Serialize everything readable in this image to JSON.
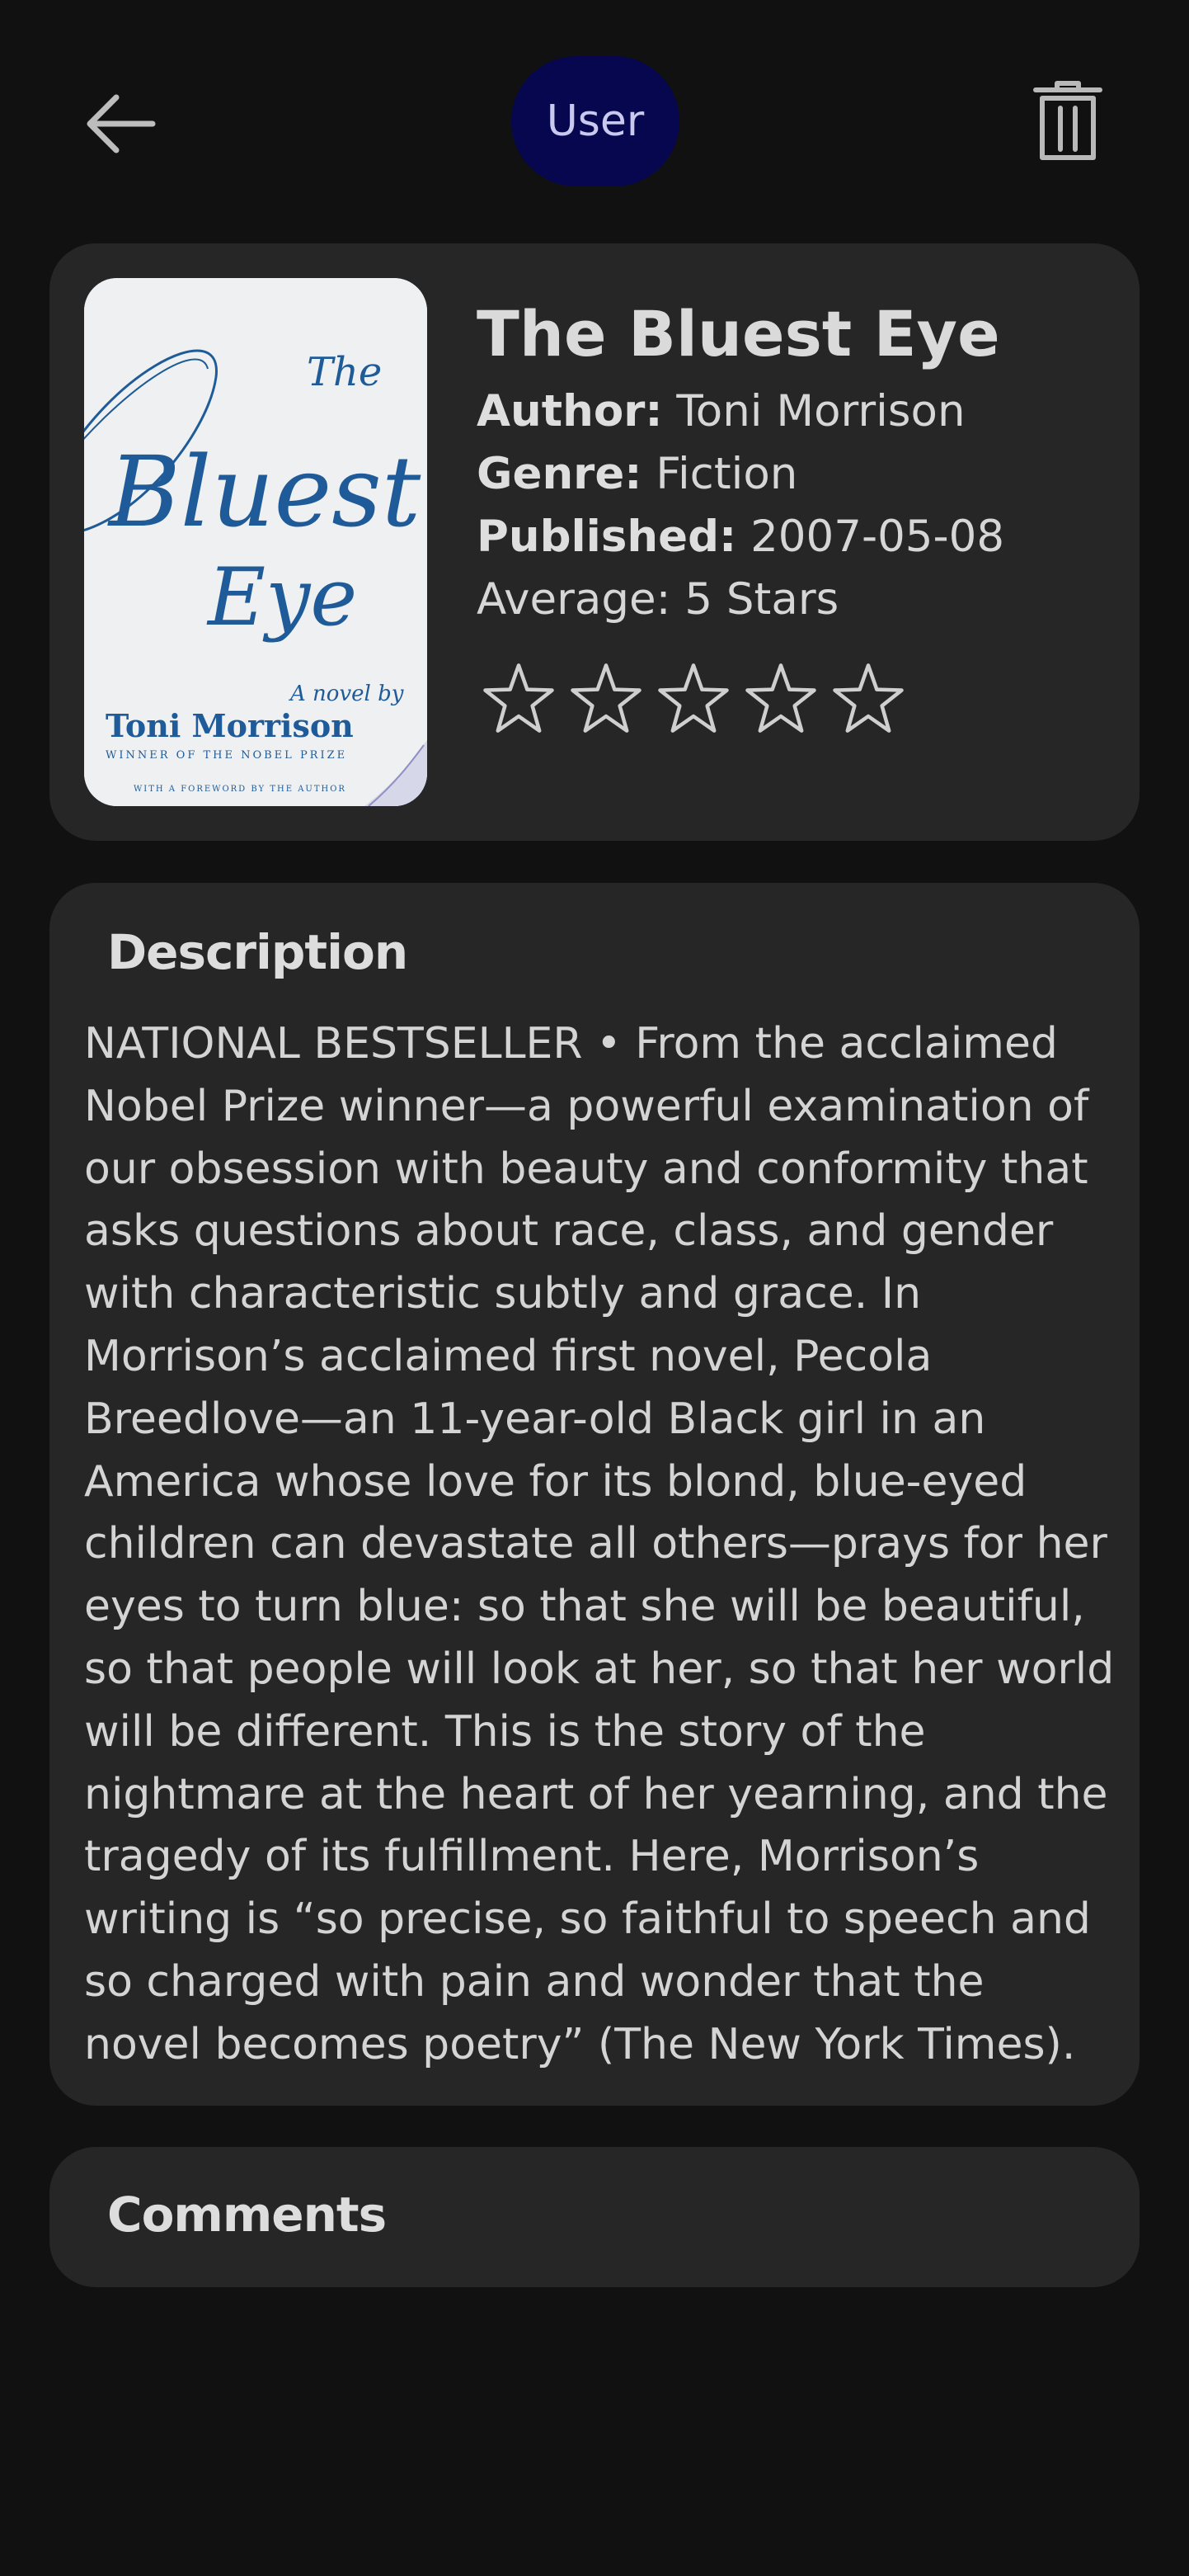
{
  "header": {
    "back_icon": "arrow-left-icon",
    "user_label": "User",
    "user_pill_color": "#07074f",
    "delete_icon": "trash-icon"
  },
  "book": {
    "title": "The Bluest Eye",
    "author_label": "Author:",
    "author": "Toni Morrison",
    "genre_label": "Genre:",
    "genre": "Fiction",
    "published_label": "Published:",
    "published": "2007-05-08",
    "average_text": "Average: 5 Stars",
    "rating_star_count": 5,
    "rating_selected": 0,
    "cover": {
      "title_word_1": "The",
      "title_word_2": "Bluest",
      "title_word_3": "Eye",
      "subtitle": "A novel by",
      "author": "Toni Morrison",
      "tagline": "WINNER OF THE NOBEL PRIZE",
      "footer": "WITH A FOREWORD BY THE AUTHOR",
      "ink_color": "#1f5b98"
    }
  },
  "description": {
    "heading": "Description",
    "text": "NATIONAL BESTSELLER • From the acclaimed Nobel Prize winner—a powerful examination of our obsession with beauty and conformity that asks questions about race, class, and gender with characteristic subtly and grace. In Morrison’s acclaimed first novel, Pecola Breedlove—an 11-year-old Black girl in an America whose love for its blond, blue-eyed children can devastate all others—prays for her eyes to turn blue: so that she will be beautiful, so that people will look at her, so that her world will be different. This is the story of the nightmare at the heart of her yearning, and the tragedy of its fulfillment. Here, Morrison’s writing is “so precise, so faithful to speech and so charged with pain and wonder that the novel becomes poetry” (The New York Times)."
  },
  "comments": {
    "heading": "Comments"
  },
  "theme": {
    "background": "#111111",
    "card": "#262626",
    "text": "#d8d8d8"
  }
}
